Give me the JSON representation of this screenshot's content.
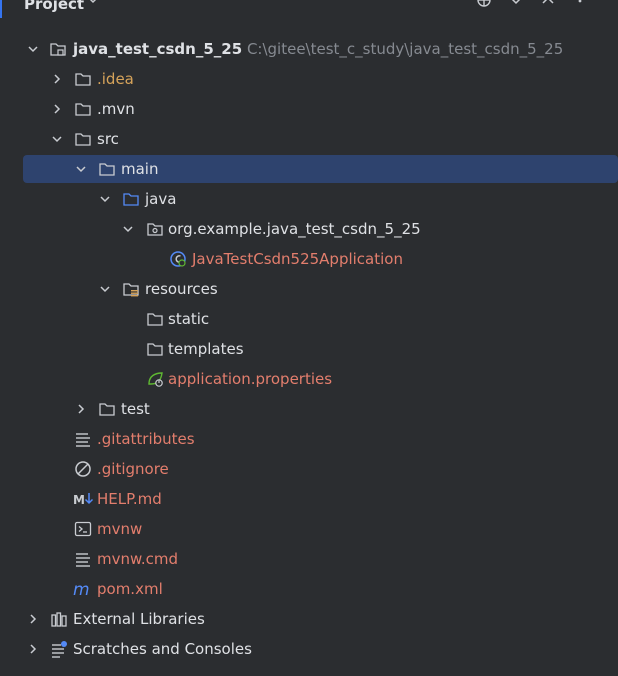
{
  "header": {
    "title": "Project"
  },
  "tree": [
    {
      "label": "java_test_csdn_5_25",
      "path": "C:\\gitee\\test_c_study\\java_test_csdn_5_25"
    },
    {
      "label": ".idea"
    },
    {
      "label": ".mvn"
    },
    {
      "label": "src"
    },
    {
      "label": "main"
    },
    {
      "label": "java"
    },
    {
      "label": "org.example.java_test_csdn_5_25"
    },
    {
      "label": "JavaTestCsdn525Application"
    },
    {
      "label": "resources"
    },
    {
      "label": "static"
    },
    {
      "label": "templates"
    },
    {
      "label": "application.properties"
    },
    {
      "label": "test"
    },
    {
      "label": ".gitattributes"
    },
    {
      "label": ".gitignore"
    },
    {
      "label": "HELP.md"
    },
    {
      "label": "mvnw"
    },
    {
      "label": "mvnw.cmd"
    },
    {
      "label": "pom.xml"
    },
    {
      "label": "External Libraries"
    },
    {
      "label": "Scratches and Consoles"
    }
  ],
  "colors": {
    "background": "#2b2d30",
    "selection": "#2e436e",
    "vcs_unversioned": "#e37e6d",
    "ignored": "#d6a35a",
    "path_gray": "#868a91"
  }
}
